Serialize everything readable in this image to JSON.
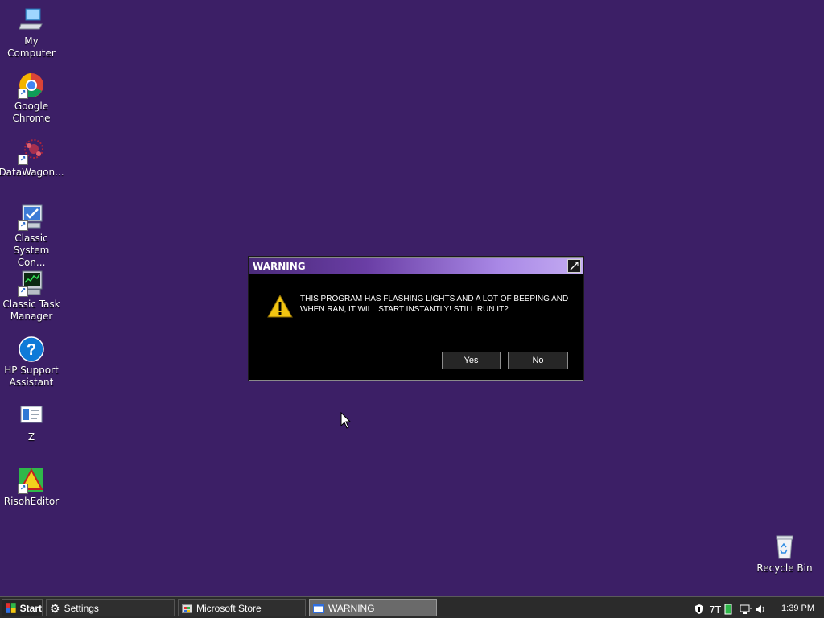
{
  "desktop": {
    "icons": [
      {
        "label": "My Computer"
      },
      {
        "label": "Google\nChrome"
      },
      {
        "label": "DataWagon..."
      },
      {
        "label": "Classic\nSystem Con..."
      },
      {
        "label": "Classic Task\nManager"
      },
      {
        "label": "HP Support\nAssistant"
      },
      {
        "label": "Z"
      },
      {
        "label": "RisohEditor"
      },
      {
        "label": "Recycle Bin"
      }
    ]
  },
  "dialog": {
    "title": "WARNING",
    "message": "THIS PROGRAM HAS FLASHING LIGHTS AND A LOT OF BEEPING AND WHEN RAN, IT WILL START INSTANTLY! STILL RUN IT?",
    "yes_label": "Yes",
    "no_label": "No"
  },
  "taskbar": {
    "start_label": "Start",
    "items": [
      {
        "label": "Settings",
        "icon": "gear-icon"
      },
      {
        "label": "Microsoft Store",
        "icon": "store-icon"
      },
      {
        "label": "WARNING",
        "icon": "window-icon",
        "active": true
      }
    ],
    "clock": "1:39 PM"
  },
  "colors": {
    "desktop_bg": "#3c1f66",
    "title_gradient_start": "#4a2a7a",
    "title_gradient_end": "#c4acf2",
    "taskbar_bg": "#2b2b2b"
  }
}
